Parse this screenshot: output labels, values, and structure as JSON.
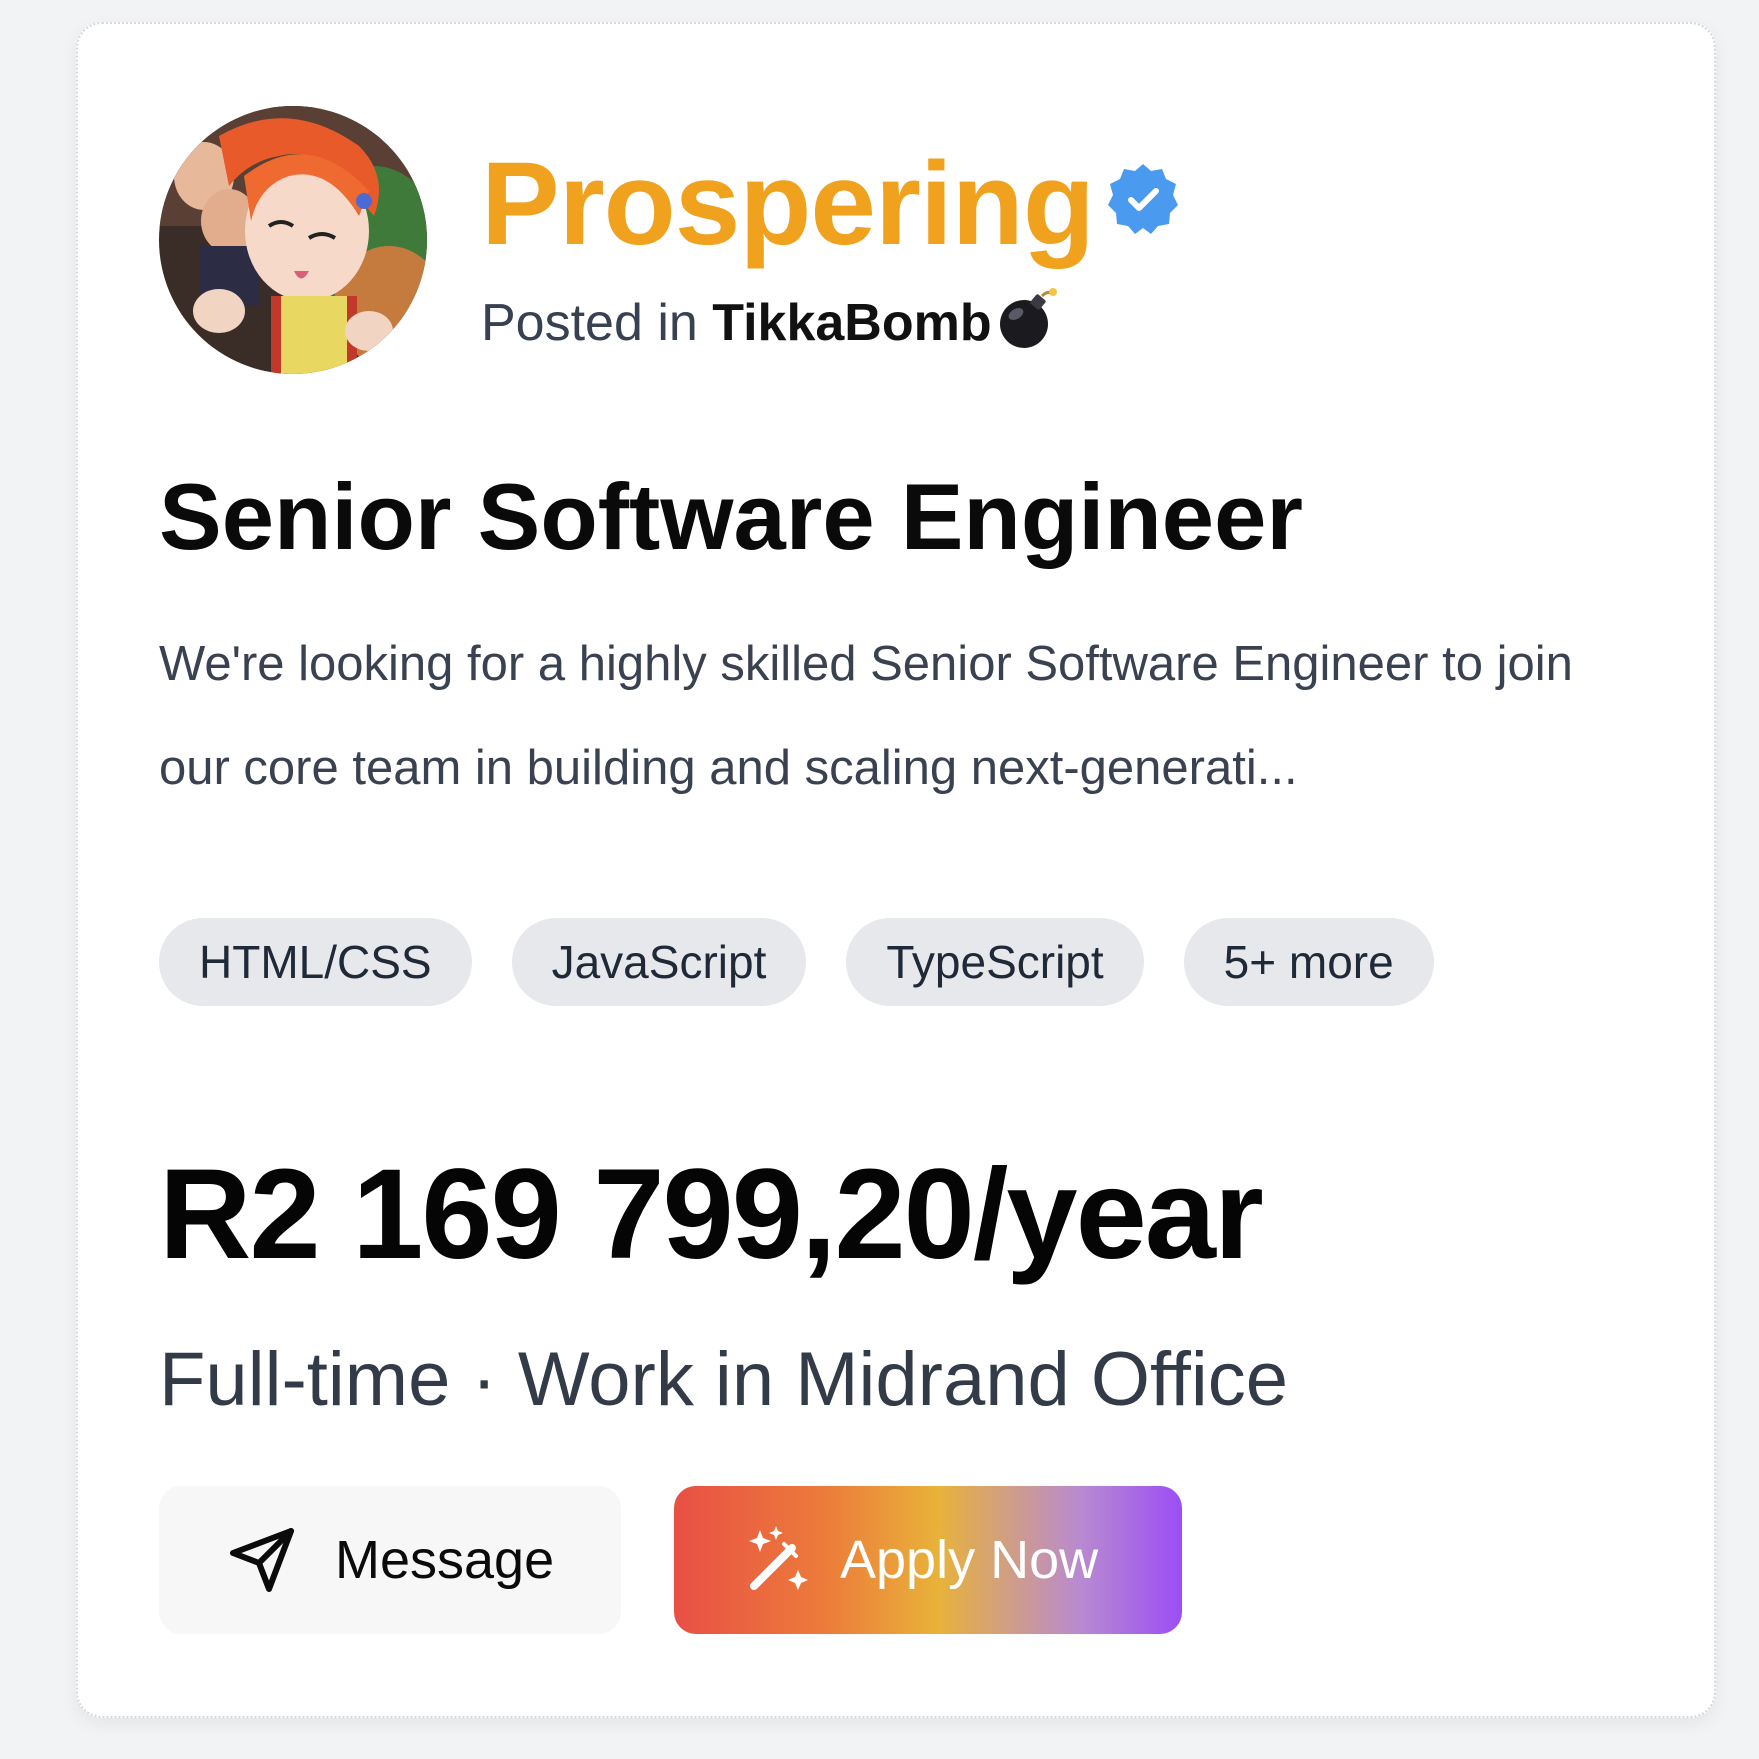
{
  "poster": {
    "name": "Prospering",
    "verified_icon": "verified-badge-icon",
    "posted_prefix": "Posted in",
    "company": "TikkaBomb",
    "company_emoji_icon": "bomb-icon"
  },
  "job": {
    "title": "Senior Software Engineer",
    "description": "We're looking for a highly skilled Senior Software Engineer to join our core team in building and scaling next-generati...",
    "tags": [
      "HTML/CSS",
      "JavaScript",
      "TypeScript",
      "5+ more"
    ],
    "salary": "R2 169 799,20/year",
    "meta": "Full-time · Work in Midrand Office"
  },
  "actions": {
    "message_label": "Message",
    "message_icon": "send-icon",
    "apply_label": "Apply Now",
    "apply_icon": "magic-wand-icon"
  },
  "colors": {
    "brand": "#f0a21e",
    "verified": "#4a9af0",
    "apply_gradient": [
      "#e94f45",
      "#ec7c3a",
      "#e8b23a",
      "#b88ad0",
      "#9b4ef5"
    ]
  }
}
